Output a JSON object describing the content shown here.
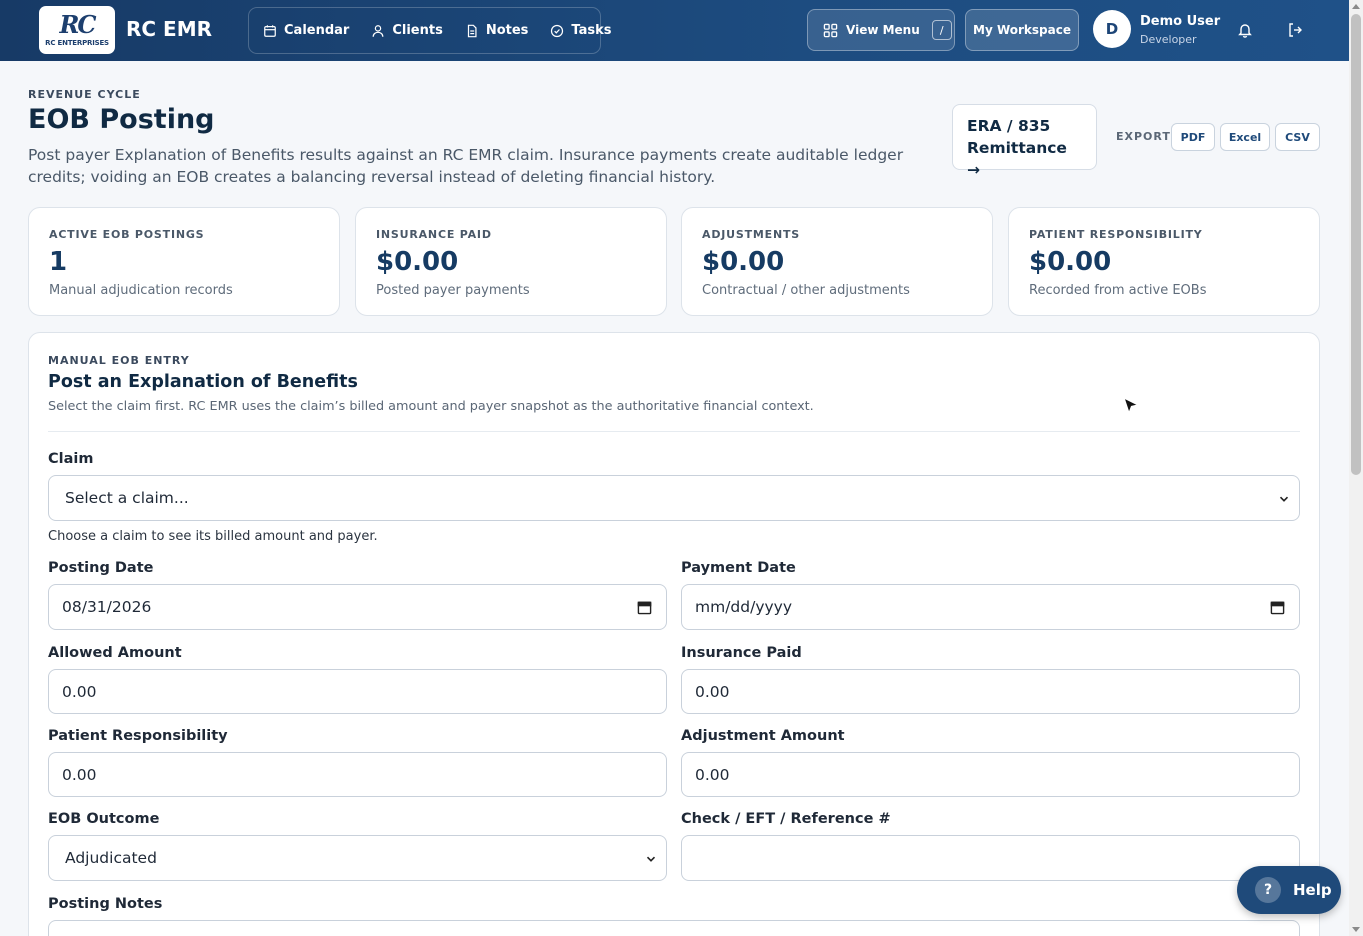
{
  "header": {
    "logo_mark": "RC",
    "logo_sub": "RC ENTERPRISES",
    "brand": "RC EMR",
    "nav": [
      {
        "label": "Calendar"
      },
      {
        "label": "Clients"
      },
      {
        "label": "Notes"
      },
      {
        "label": "Tasks"
      }
    ],
    "view_menu": "View Menu",
    "view_menu_shortcut": "/",
    "workspace": "My Workspace",
    "avatar_initial": "D",
    "user_name": "Demo User",
    "user_role": "Developer"
  },
  "page": {
    "eyebrow": "REVENUE CYCLE",
    "title": "EOB Posting",
    "description": "Post payer Explanation of Benefits results against an RC EMR claim. Insurance payments create auditable ledger credits; voiding an EOB creates a balancing reversal instead of deleting financial history.",
    "era_line1": "ERA / 835",
    "era_line2": "Remittance →",
    "export_label": "EXPORT",
    "export_pdf": "PDF",
    "export_excel": "Excel",
    "export_csv": "CSV"
  },
  "stats": [
    {
      "label": "ACTIVE EOB POSTINGS",
      "value": "1",
      "sub": "Manual adjudication records"
    },
    {
      "label": "INSURANCE PAID",
      "value": "$0.00",
      "sub": "Posted payer payments"
    },
    {
      "label": "ADJUSTMENTS",
      "value": "$0.00",
      "sub": "Contractual / other adjustments"
    },
    {
      "label": "PATIENT RESPONSIBILITY",
      "value": "$0.00",
      "sub": "Recorded from active EOBs"
    }
  ],
  "form": {
    "eyebrow": "MANUAL EOB ENTRY",
    "title": "Post an Explanation of Benefits",
    "description": "Select the claim first. RC EMR uses the claim’s billed amount and payer snapshot as the authoritative financial context.",
    "claim_label": "Claim",
    "claim_value": "Select a claim...",
    "claim_hint": "Choose a claim to see its billed amount and payer.",
    "posting_date_label": "Posting Date",
    "posting_date_value": "08/31/2026",
    "payment_date_label": "Payment Date",
    "payment_date_value": "mm/dd/yyyy",
    "allowed_label": "Allowed Amount",
    "allowed_value": "0.00",
    "ins_paid_label": "Insurance Paid",
    "ins_paid_value": "0.00",
    "patient_resp_label": "Patient Responsibility",
    "patient_resp_value": "0.00",
    "adjustment_label": "Adjustment Amount",
    "adjustment_value": "0.00",
    "outcome_label": "EOB Outcome",
    "outcome_value": "Adjudicated",
    "reference_label": "Check / EFT / Reference #",
    "reference_value": "",
    "notes_label": "Posting Notes"
  },
  "help": {
    "icon": "?",
    "label": "Help"
  },
  "colors": {
    "header_start": "#173a66",
    "header_end": "#1f5188",
    "accent": "#1f4a7a"
  }
}
